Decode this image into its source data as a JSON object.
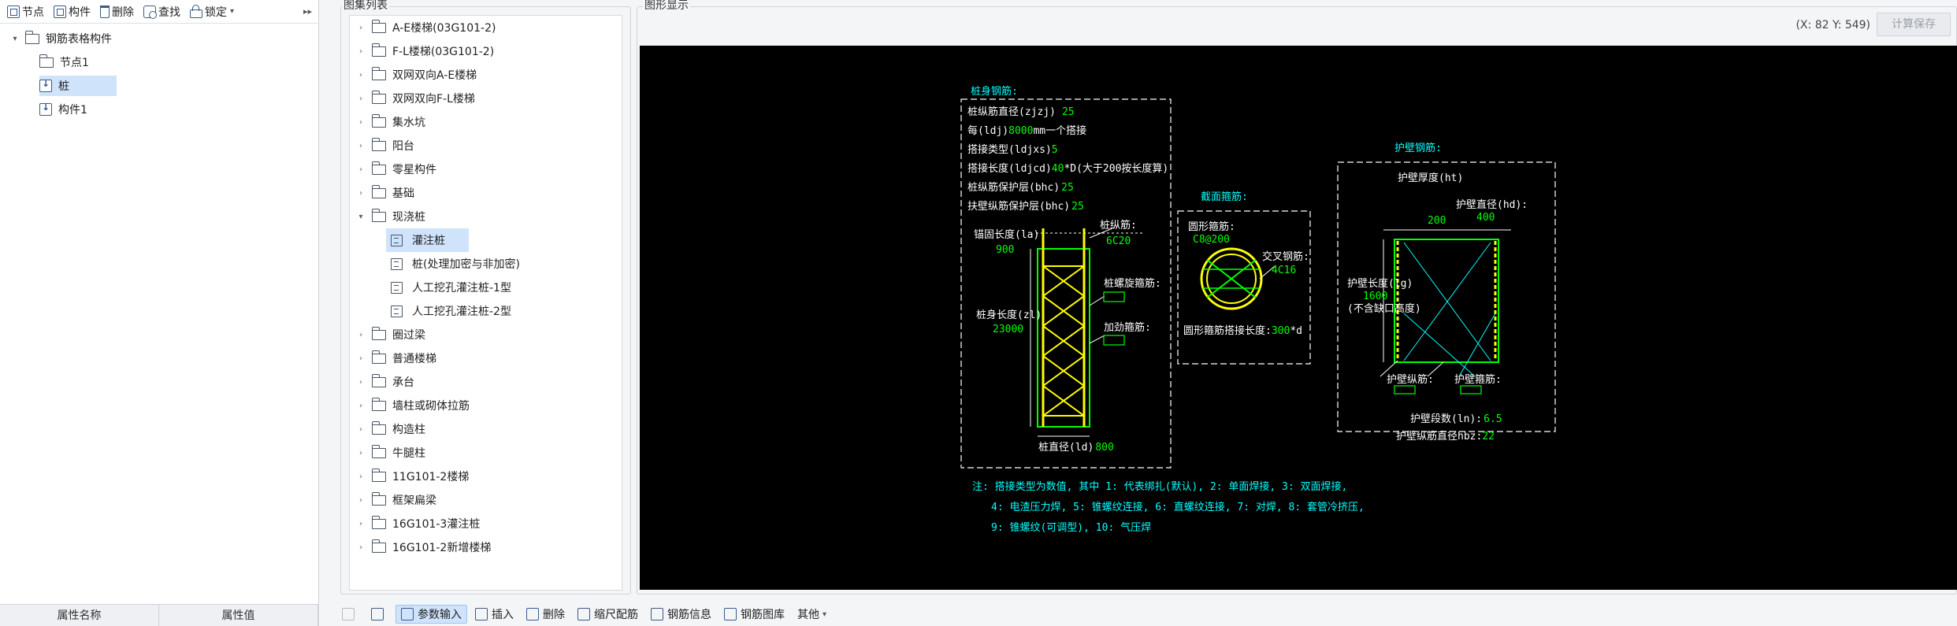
{
  "left_toolbar": {
    "node_label": "节点",
    "component_label": "构件",
    "delete_label": "删除",
    "find_label": "查找",
    "lock_label": "锁定",
    "more_label": "▸▸"
  },
  "left_tree": {
    "root": "钢筋表格构件",
    "items": [
      "节点1",
      "桩",
      "构件1"
    ]
  },
  "properties": {
    "col_name": "属性名称",
    "col_value": "属性值"
  },
  "atlas": {
    "title": "图集列表",
    "items": [
      "A-E楼梯(03G101-2)",
      "F-L楼梯(03G101-2)",
      "双网双向A-E楼梯",
      "双网双向F-L楼梯",
      "集水坑",
      "阳台",
      "零星构件",
      "基础",
      "现浇桩"
    ],
    "children": [
      "灌注桩",
      "桩(处理加密与非加密)",
      "人工挖孔灌注桩-1型",
      "人工挖孔灌注桩-2型"
    ],
    "items_after": [
      "圈过梁",
      "普通楼梯",
      "承台",
      "墙柱或砌体拉筋",
      "构造柱",
      "牛腿柱",
      "11G101-2楼梯",
      "框架扁梁",
      "16G101-3灌注桩",
      "16G101-2新增楼梯"
    ]
  },
  "graphic": {
    "title": "图形显示",
    "coords": "(X: 82 Y: 549)",
    "calc_label": "计算保存"
  },
  "drawing": {
    "body_title": "桩身钢筋:",
    "diam_label": "桩纵筋直径(zjzj)",
    "diam_val": "25",
    "every_label_a": "每(ldj)",
    "every_val": "8000",
    "every_label_b": "mm一个搭接",
    "lap_type_label": "搭接类型(ldjxs)",
    "lap_type_val": "5",
    "lap_len_label": "搭接长度(ldjcd)",
    "lap_len_val": "40",
    "lap_len_tail": "*D(大于200按长度算)",
    "cover_label": "桩纵筋保护层(bhc)",
    "cover_val": "25",
    "cover2_label": "扶壁纵筋保护层(bhc)",
    "cover2_val": "25",
    "anchor_label": "锚固长度(la)",
    "anchor_val": "900",
    "long_bar_label": "桩纵筋:",
    "long_bar_val": "6C20",
    "spiral_label": "桩螺旋箍筋:",
    "body_len_label": "桩身长度(zl)",
    "body_len_val": "23000",
    "stiff_label": "加劲箍筋:",
    "pile_diam_label": "桩直径(ld)",
    "pile_diam_val": "800",
    "section_title": "截面箍筋:",
    "circ_stirrup_label": "圆形箍筋:",
    "circ_stirrup_val": "C8@200",
    "cross_label": "交叉钢筋:",
    "cross_val": "4C16",
    "circ_lap_label": "圆形箍筋搭接长度:",
    "circ_lap_val": "300",
    "circ_lap_tail": "*d",
    "wall_title": "护壁钢筋:",
    "wall_thick_label": "护壁厚度(ht)",
    "wall_thick_val": "200",
    "wall_diam_label": "护壁直径(hd):",
    "wall_diam_val": "400",
    "wall_len_label": "护壁长度(lg)",
    "wall_len_val": "1600",
    "wall_len_note": "(不含缺口高度)",
    "wall_long_label": "护壁纵筋:",
    "wall_stirrup_label": "护壁箍筋:",
    "wall_seg_label": "护壁段数(ln):",
    "wall_seg_val": "6.5",
    "wall_bar_diam_label": "护壁纵筋直径hbz:",
    "wall_bar_diam_val": "22",
    "note1": "注: 搭接类型为数值, 其中 1: 代表绑扎(默认), 2: 单面焊接, 3: 双面焊接,",
    "note2": "4: 电渣压力焊, 5: 锥螺纹连接, 6: 直螺纹连接, 7: 对焊, 8: 套管冷挤压,",
    "note3": "9: 锥螺纹(可调型), 10: 气压焊"
  },
  "bottom_toolbar": {
    "param_input": "参数输入",
    "insert": "插入",
    "delete": "删除",
    "scale_rebar": "缩尺配筋",
    "rebar_info": "钢筋信息",
    "rebar_lib": "钢筋图库",
    "other": "其他"
  },
  "colors": {
    "cad_bg": "#000000",
    "cad_white": "#ffffff",
    "cad_green": "#00ff00",
    "cad_cyan": "#00ffff",
    "cad_yellow": "#ffff00",
    "selection": "#cfe3fb"
  }
}
